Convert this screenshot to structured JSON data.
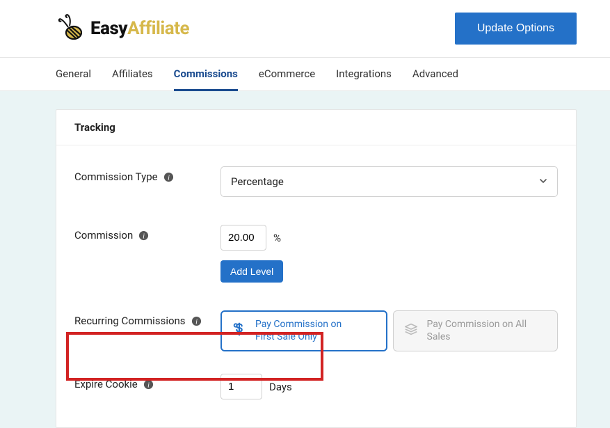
{
  "header": {
    "logo_easy": "Easy",
    "logo_affiliate": "Affiliate",
    "update_button": "Update Options"
  },
  "tabs": [
    {
      "label": "General"
    },
    {
      "label": "Affiliates"
    },
    {
      "label": "Commissions"
    },
    {
      "label": "eCommerce"
    },
    {
      "label": "Integrations"
    },
    {
      "label": "Advanced"
    }
  ],
  "active_tab_index": 2,
  "panel": {
    "title": "Tracking",
    "commission_type": {
      "label": "Commission Type",
      "value": "Percentage"
    },
    "commission": {
      "label": "Commission",
      "value": "20.00",
      "unit": "%",
      "add_level": "Add Level"
    },
    "recurring": {
      "label": "Recurring Commissions",
      "option_first": "Pay Commission on First Sale Only",
      "option_all": "Pay Commission on All Sales"
    },
    "expire_cookie": {
      "label": "Expire Cookie",
      "value": "1",
      "unit": "Days"
    }
  }
}
